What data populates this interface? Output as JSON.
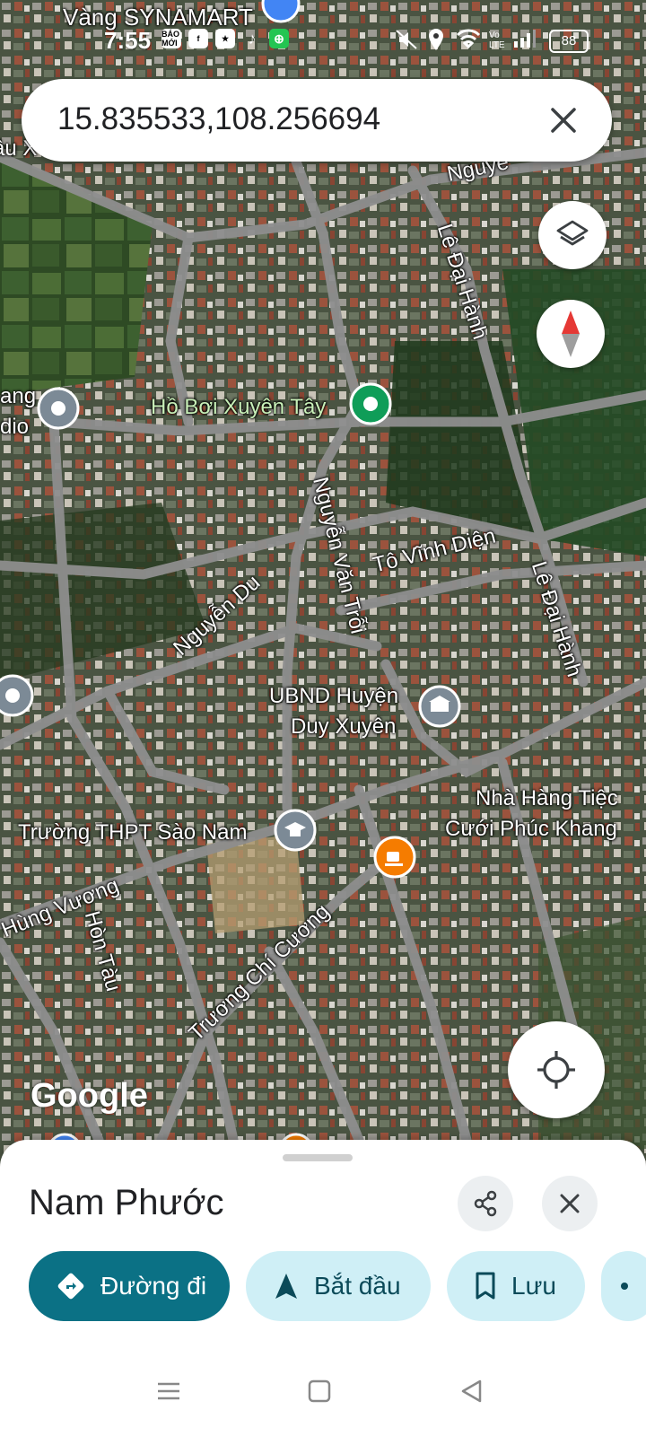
{
  "status_bar": {
    "time": "7:55",
    "app_icons": [
      "baomoi-icon",
      "facebook-icon",
      "star-app-icon",
      "tiktok-icon",
      "shopping-icon"
    ],
    "app_icon_texts": [
      "BÁO MỚI",
      "f",
      "★",
      "♪",
      "⊕"
    ],
    "battery": "88"
  },
  "search": {
    "query": "15.835533,108.256694"
  },
  "map": {
    "labels": [
      {
        "text": "Vàng SYNAMART"
      },
      {
        "text": "âu X"
      },
      {
        "text": "Nguyễ"
      },
      {
        "text": "Lê Đại Hành"
      },
      {
        "text": "ang"
      },
      {
        "text": "dio"
      },
      {
        "text": "Hồ Bơi Xuyên Tây"
      },
      {
        "text": "Nguyễn Văn Trỗi"
      },
      {
        "text": "Tô Vĩnh Diện"
      },
      {
        "text": "Lê Đại Hành"
      },
      {
        "text": "Nguyễn Du"
      },
      {
        "text": "UBND Huyện"
      },
      {
        "text": "Duy Xuyên"
      },
      {
        "text": "Nhà Hàng Tiệc"
      },
      {
        "text": "Cưới Phúc Khang"
      },
      {
        "text": "Trường THPT Sào Nam"
      },
      {
        "text": "Hùng Vương"
      },
      {
        "text": "Hòn Tàu"
      },
      {
        "text": "Trương Chí Cương"
      }
    ],
    "attribution": "Google"
  },
  "bottom_sheet": {
    "place_name": "Nam Phước",
    "actions": [
      {
        "label": "Đường đi",
        "icon": "directions-icon"
      },
      {
        "label": "Bắt đầu",
        "icon": "navigation-arrow-icon"
      },
      {
        "label": "Lưu",
        "icon": "bookmark-icon"
      }
    ]
  },
  "colors": {
    "primary": "#0b7185",
    "chip_bg": "#cfeff6",
    "pin_green": "#0f9d58",
    "pin_gray": "#7c8a96",
    "pin_orange": "#f57c00",
    "compass_red": "#e53935"
  }
}
